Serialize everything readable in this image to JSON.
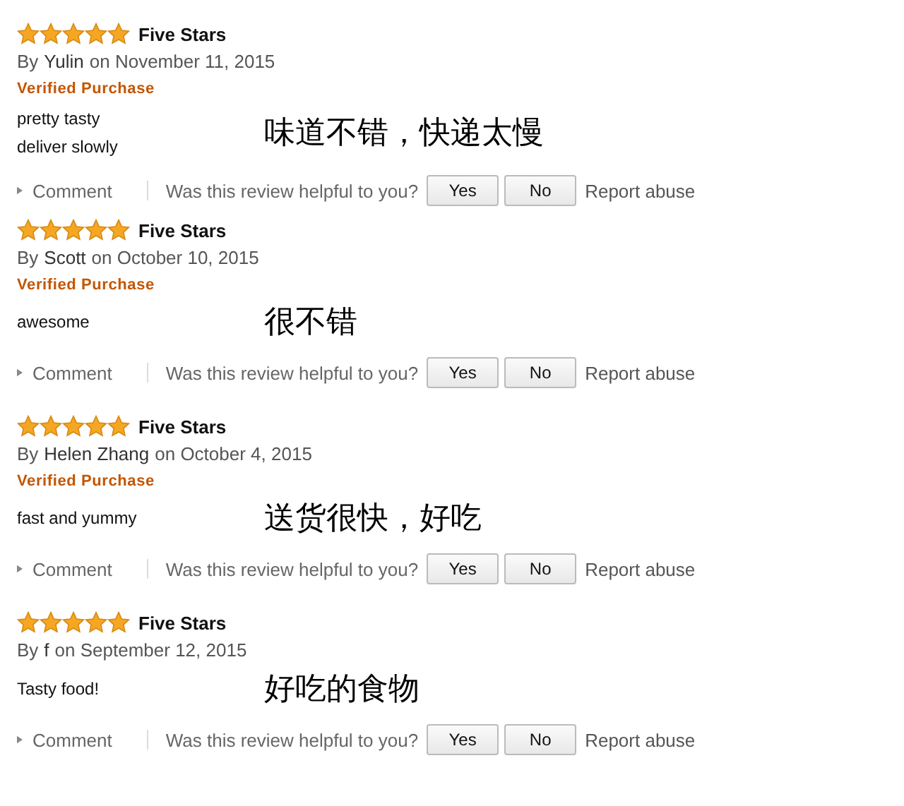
{
  "reviews": [
    {
      "stars": 5,
      "title": "Five Stars",
      "by": "By",
      "author": "Yulin",
      "date": "on November 11, 2015",
      "verified": "Verified Purchase",
      "body": [
        "pretty tasty",
        "deliver slowly"
      ],
      "note": "味道不错，快递太慢",
      "comment": "Comment",
      "helpful": "Was this review helpful to you?",
      "yes": "Yes",
      "no": "No",
      "report": "Report abuse"
    },
    {
      "stars": 5,
      "title": "Five Stars",
      "by": "By",
      "author": "Scott",
      "date": "on October 10, 2015",
      "verified": "Verified Purchase",
      "body": [
        "awesome"
      ],
      "note": "很不错",
      "comment": "Comment",
      "helpful": "Was this review helpful to you?",
      "yes": "Yes",
      "no": "No",
      "report": "Report abuse"
    },
    {
      "stars": 5,
      "title": "Five Stars",
      "by": "By",
      "author": "Helen Zhang",
      "date": "on October 4, 2015",
      "verified": "Verified Purchase",
      "body": [
        "fast and yummy"
      ],
      "note": "送货很快，好吃",
      "comment": "Comment",
      "helpful": "Was this review helpful to you?",
      "yes": "Yes",
      "no": "No",
      "report": "Report abuse"
    },
    {
      "stars": 5,
      "title": "Five Stars",
      "by": "By",
      "author": "f",
      "date": "on September 12, 2015",
      "body": [
        "Tasty food!"
      ],
      "note": "好吃的食物",
      "comment": "Comment",
      "helpful": "Was this review helpful to you?",
      "yes": "Yes",
      "no": "No",
      "report": "Report abuse"
    }
  ]
}
